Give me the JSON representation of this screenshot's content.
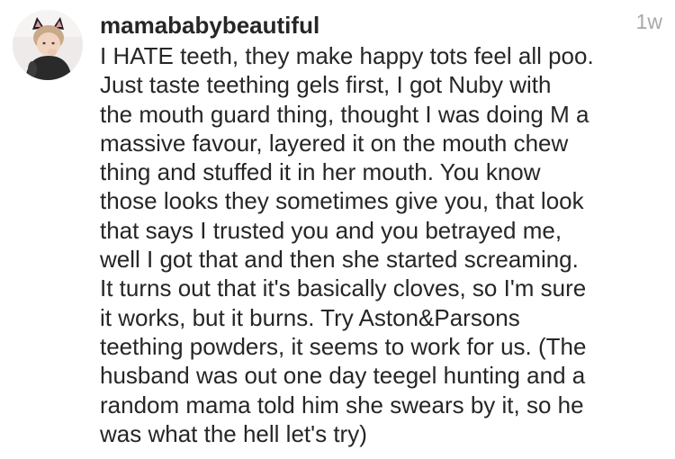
{
  "comment": {
    "username": "mamababybeautiful",
    "timestamp": "1w",
    "avatar_icon": "profile-photo-child-cat-ears",
    "text_lines": [
      "I HATE teeth, they make happy tots feel all poo.",
      "Just taste teething gels first, I got Nuby with",
      "the mouth guard thing, thought I was doing M a",
      "massive favour, layered it on the mouth chew",
      "thing and stuffed it in her mouth. You know",
      "those looks they sometimes give you, that look",
      "that says I trusted you and you betrayed me,",
      "well I got that and then she started screaming.",
      "It turns out that it's basically cloves, so I'm sure",
      "it works, but it burns. Try Aston&Parsons",
      "teething powders, it seems to work for us. (The",
      "husband was out one day teegel hunting and a",
      "random mama told him she swears by it, so he",
      "was what the hell let's try)"
    ]
  },
  "colors": {
    "text": "#262626",
    "timestamp": "#a8a8a8",
    "background": "#ffffff"
  }
}
